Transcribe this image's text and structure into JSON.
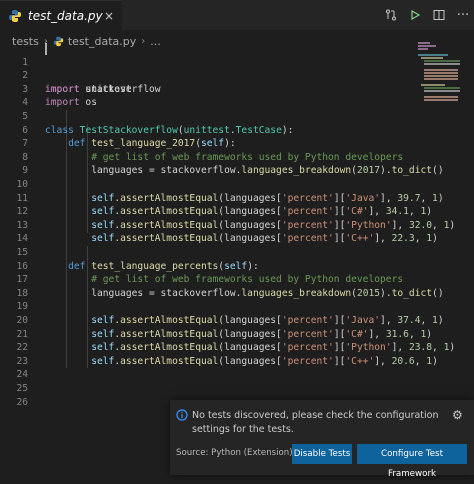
{
  "tab": {
    "title": "test_data.py",
    "close_glyph": "×"
  },
  "toolbar": {
    "actions": [
      "compare-icon",
      "run-icon",
      "split-editor-icon",
      "more-actions-icon"
    ],
    "more_glyph": "···"
  },
  "breadcrumb": {
    "folder": "tests",
    "file": "test_data.py",
    "tail": "..."
  },
  "editor": {
    "line_numbers": [
      "1",
      "2",
      "3",
      "4",
      "5",
      "6",
      "7",
      "8",
      "9",
      "10",
      "11",
      "12",
      "13",
      "14",
      "15",
      "16",
      "17",
      "18",
      "19",
      "20",
      "21",
      "22",
      "23",
      "24",
      "25",
      "26"
    ],
    "lines": {
      "l1_kw": "import",
      "l1_rest": " unittest",
      "l2_kw": "import",
      "l2_rest": " stackoverflow",
      "l3_kw": "import",
      "l3_rest": " os",
      "l5_kw": "class",
      "l5_name": "TestStackoverflow",
      "l5_open": "(",
      "l5_base1": "unittest",
      "l5_dot": ".",
      "l5_base2": "TestCase",
      "l5_close": "):",
      "l6_kw": "def",
      "l6_name": "test_language_2017",
      "l6_open": "(",
      "l6_self": "self",
      "l6_close": "):",
      "l7_com": "# get list of web frameworks used by Python developers",
      "l8_a": "languages = stackoverflow.",
      "l8_fn": "languages_breakdown",
      "l8_b": "(",
      "l8_num": "2017",
      "l8_c": ").",
      "l8_fn2": "to_dict",
      "l8_d": "()",
      "l10_self": "self",
      "l10_fn": ".assertAlmostEqual",
      "l10_a": "(languages[",
      "l10_s1": "'percent'",
      "l10_b": "][",
      "l10_s2": "'Java'",
      "l10_c": "], ",
      "l10_n1": "39.7",
      "l10_d": ", ",
      "l10_n2": "1",
      "l10_e": ")",
      "l11_self": "self",
      "l11_fn": ".assertAlmostEqual",
      "l11_a": "(languages[",
      "l11_s1": "'percent'",
      "l11_b": "][",
      "l11_s2": "'C#'",
      "l11_c": "], ",
      "l11_n1": "34.1",
      "l11_d": ", ",
      "l11_n2": "1",
      "l11_e": ")",
      "l12_self": "self",
      "l12_fn": ".assertAlmostEqual",
      "l12_a": "(languages[",
      "l12_s1": "'percent'",
      "l12_b": "][",
      "l12_s2": "'Python'",
      "l12_c": "], ",
      "l12_n1": "32.0",
      "l12_d": ", ",
      "l12_n2": "1",
      "l12_e": ")",
      "l13_self": "self",
      "l13_fn": ".assertAlmostEqual",
      "l13_a": "(languages[",
      "l13_s1": "'percent'",
      "l13_b": "][",
      "l13_s2": "'C++'",
      "l13_c": "], ",
      "l13_n1": "22.3",
      "l13_d": ", ",
      "l13_n2": "1",
      "l13_e": ")",
      "l15_kw": "def",
      "l15_name": "test_language_percents",
      "l15_open": "(",
      "l15_self": "self",
      "l15_close": "):",
      "l16_com": "# get list of web frameworks used by Python developers",
      "l17_a": "languages = stackoverflow.",
      "l17_fn": "languages_breakdown",
      "l17_b": "(",
      "l17_num": "2015",
      "l17_c": ").",
      "l17_fn2": "to_dict",
      "l17_d": "()",
      "l19_self": "self",
      "l19_fn": ".assertAlmostEqual",
      "l19_a": "(languages[",
      "l19_s1": "'percent'",
      "l19_b": "][",
      "l19_s2": "'Java'",
      "l19_c": "], ",
      "l19_n1": "37.4",
      "l19_d": ", ",
      "l19_n2": "1",
      "l19_e": ")",
      "l20_self": "self",
      "l20_fn": ".assertAlmostEqual",
      "l20_a": "(languages[",
      "l20_s1": "'percent'",
      "l20_b": "][",
      "l20_s2": "'C#'",
      "l20_c": "], ",
      "l20_n1": "31.6",
      "l20_d": ", ",
      "l20_n2": "1",
      "l20_e": ")",
      "l21_self": "self",
      "l21_fn": ".assertAlmostEqual",
      "l21_a": "(languages[",
      "l21_s1": "'percent'",
      "l21_b": "][",
      "l21_s2": "'Python'",
      "l21_c": "], ",
      "l21_n1": "23.8",
      "l21_d": ", ",
      "l21_n2": "1",
      "l21_e": ")",
      "l22_self": "self",
      "l22_fn": ".assertAlmostEqual",
      "l22_a": "(languages[",
      "l22_s1": "'percent'",
      "l22_b": "][",
      "l22_s2": "'C++'",
      "l22_c": "], ",
      "l22_n1": "20.6",
      "l22_d": ", ",
      "l22_n2": "1",
      "l22_e": ")"
    }
  },
  "notification": {
    "message": "No tests discovered, please check the configuration settings for the tests.",
    "source": "Source: Python (Extension)",
    "disable_label": "Disable Tests",
    "configure_label": "Configure Test Framework",
    "gear_glyph": "⚙"
  },
  "colors": {
    "editor_bg": "#1e1e1e",
    "tab_bar_bg": "#252526",
    "button_bg": "#0e639c",
    "info_icon": "#3794ff",
    "python_icon_blue": "#3572a5",
    "python_icon_yellow": "#f7d046"
  }
}
